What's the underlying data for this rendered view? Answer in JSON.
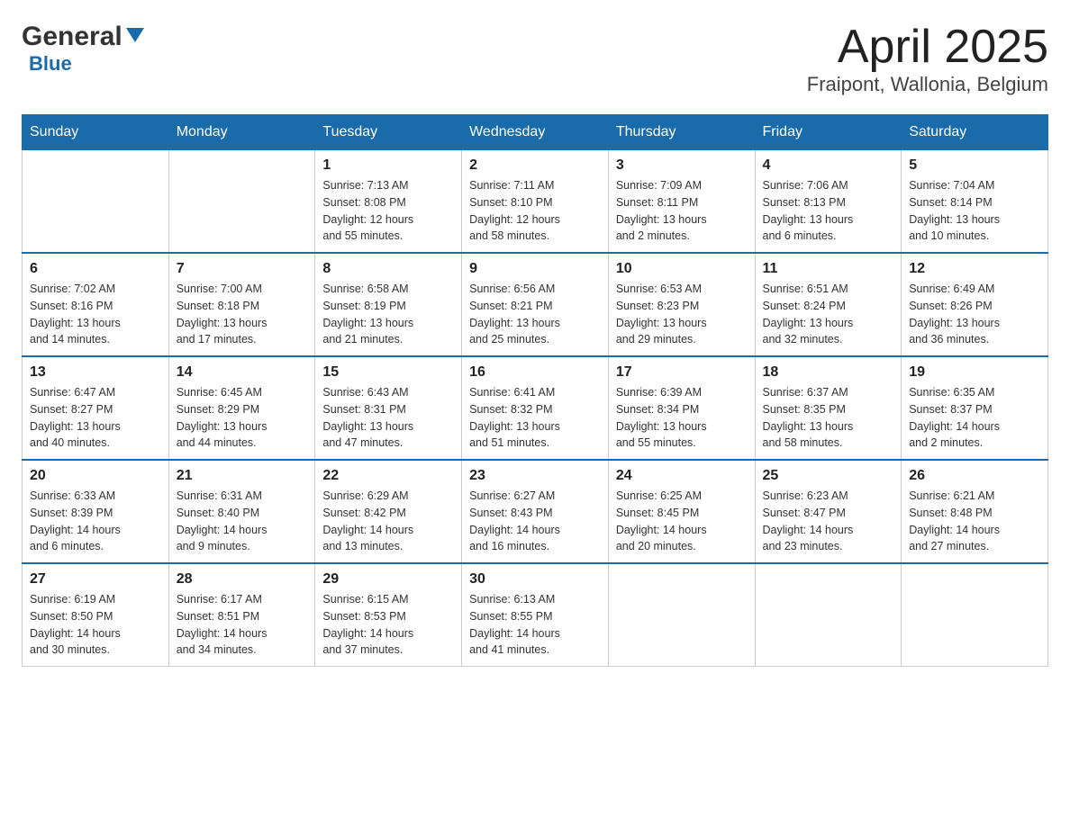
{
  "header": {
    "logo_general": "General",
    "logo_blue": "Blue",
    "title": "April 2025",
    "subtitle": "Fraipont, Wallonia, Belgium"
  },
  "days_of_week": [
    "Sunday",
    "Monday",
    "Tuesday",
    "Wednesday",
    "Thursday",
    "Friday",
    "Saturday"
  ],
  "weeks": [
    [
      {
        "day": "",
        "info": ""
      },
      {
        "day": "",
        "info": ""
      },
      {
        "day": "1",
        "info": "Sunrise: 7:13 AM\nSunset: 8:08 PM\nDaylight: 12 hours\nand 55 minutes."
      },
      {
        "day": "2",
        "info": "Sunrise: 7:11 AM\nSunset: 8:10 PM\nDaylight: 12 hours\nand 58 minutes."
      },
      {
        "day": "3",
        "info": "Sunrise: 7:09 AM\nSunset: 8:11 PM\nDaylight: 13 hours\nand 2 minutes."
      },
      {
        "day": "4",
        "info": "Sunrise: 7:06 AM\nSunset: 8:13 PM\nDaylight: 13 hours\nand 6 minutes."
      },
      {
        "day": "5",
        "info": "Sunrise: 7:04 AM\nSunset: 8:14 PM\nDaylight: 13 hours\nand 10 minutes."
      }
    ],
    [
      {
        "day": "6",
        "info": "Sunrise: 7:02 AM\nSunset: 8:16 PM\nDaylight: 13 hours\nand 14 minutes."
      },
      {
        "day": "7",
        "info": "Sunrise: 7:00 AM\nSunset: 8:18 PM\nDaylight: 13 hours\nand 17 minutes."
      },
      {
        "day": "8",
        "info": "Sunrise: 6:58 AM\nSunset: 8:19 PM\nDaylight: 13 hours\nand 21 minutes."
      },
      {
        "day": "9",
        "info": "Sunrise: 6:56 AM\nSunset: 8:21 PM\nDaylight: 13 hours\nand 25 minutes."
      },
      {
        "day": "10",
        "info": "Sunrise: 6:53 AM\nSunset: 8:23 PM\nDaylight: 13 hours\nand 29 minutes."
      },
      {
        "day": "11",
        "info": "Sunrise: 6:51 AM\nSunset: 8:24 PM\nDaylight: 13 hours\nand 32 minutes."
      },
      {
        "day": "12",
        "info": "Sunrise: 6:49 AM\nSunset: 8:26 PM\nDaylight: 13 hours\nand 36 minutes."
      }
    ],
    [
      {
        "day": "13",
        "info": "Sunrise: 6:47 AM\nSunset: 8:27 PM\nDaylight: 13 hours\nand 40 minutes."
      },
      {
        "day": "14",
        "info": "Sunrise: 6:45 AM\nSunset: 8:29 PM\nDaylight: 13 hours\nand 44 minutes."
      },
      {
        "day": "15",
        "info": "Sunrise: 6:43 AM\nSunset: 8:31 PM\nDaylight: 13 hours\nand 47 minutes."
      },
      {
        "day": "16",
        "info": "Sunrise: 6:41 AM\nSunset: 8:32 PM\nDaylight: 13 hours\nand 51 minutes."
      },
      {
        "day": "17",
        "info": "Sunrise: 6:39 AM\nSunset: 8:34 PM\nDaylight: 13 hours\nand 55 minutes."
      },
      {
        "day": "18",
        "info": "Sunrise: 6:37 AM\nSunset: 8:35 PM\nDaylight: 13 hours\nand 58 minutes."
      },
      {
        "day": "19",
        "info": "Sunrise: 6:35 AM\nSunset: 8:37 PM\nDaylight: 14 hours\nand 2 minutes."
      }
    ],
    [
      {
        "day": "20",
        "info": "Sunrise: 6:33 AM\nSunset: 8:39 PM\nDaylight: 14 hours\nand 6 minutes."
      },
      {
        "day": "21",
        "info": "Sunrise: 6:31 AM\nSunset: 8:40 PM\nDaylight: 14 hours\nand 9 minutes."
      },
      {
        "day": "22",
        "info": "Sunrise: 6:29 AM\nSunset: 8:42 PM\nDaylight: 14 hours\nand 13 minutes."
      },
      {
        "day": "23",
        "info": "Sunrise: 6:27 AM\nSunset: 8:43 PM\nDaylight: 14 hours\nand 16 minutes."
      },
      {
        "day": "24",
        "info": "Sunrise: 6:25 AM\nSunset: 8:45 PM\nDaylight: 14 hours\nand 20 minutes."
      },
      {
        "day": "25",
        "info": "Sunrise: 6:23 AM\nSunset: 8:47 PM\nDaylight: 14 hours\nand 23 minutes."
      },
      {
        "day": "26",
        "info": "Sunrise: 6:21 AM\nSunset: 8:48 PM\nDaylight: 14 hours\nand 27 minutes."
      }
    ],
    [
      {
        "day": "27",
        "info": "Sunrise: 6:19 AM\nSunset: 8:50 PM\nDaylight: 14 hours\nand 30 minutes."
      },
      {
        "day": "28",
        "info": "Sunrise: 6:17 AM\nSunset: 8:51 PM\nDaylight: 14 hours\nand 34 minutes."
      },
      {
        "day": "29",
        "info": "Sunrise: 6:15 AM\nSunset: 8:53 PM\nDaylight: 14 hours\nand 37 minutes."
      },
      {
        "day": "30",
        "info": "Sunrise: 6:13 AM\nSunset: 8:55 PM\nDaylight: 14 hours\nand 41 minutes."
      },
      {
        "day": "",
        "info": ""
      },
      {
        "day": "",
        "info": ""
      },
      {
        "day": "",
        "info": ""
      }
    ]
  ]
}
